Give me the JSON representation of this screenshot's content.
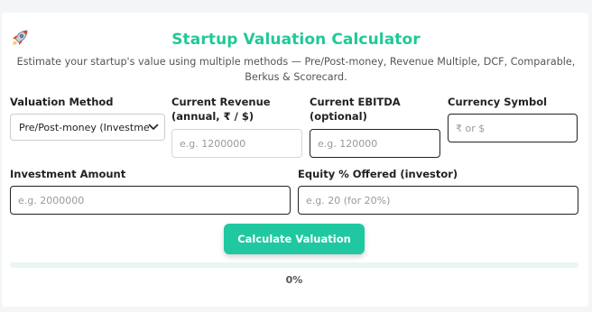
{
  "header": {
    "icon": "rocket-icon",
    "title": "Startup Valuation Calculator",
    "subtitle": "Estimate your startup's value using multiple methods — Pre/Post-money, Revenue Multiple, DCF, Comparable, Berkus & Scorecard."
  },
  "form": {
    "method": {
      "label": "Valuation Method",
      "selected": "Pre/Post-money (Investme"
    },
    "revenue": {
      "label_line1": "Current Revenue",
      "label_line2": "(annual, ₹ / $)",
      "placeholder": "e.g. 1200000"
    },
    "ebitda": {
      "label_line1": "Current EBITDA",
      "label_line2": "(optional)",
      "placeholder": "e.g. 120000"
    },
    "currency": {
      "label": "Currency Symbol",
      "placeholder": "₹ or $"
    },
    "investment": {
      "label": "Investment Amount",
      "placeholder": "e.g. 2000000"
    },
    "equity": {
      "label": "Equity % Offered (investor)",
      "placeholder": "e.g. 20 (for 20%)"
    }
  },
  "action": {
    "calculate_label": "Calculate Valuation"
  },
  "progress": {
    "value": 0,
    "label": "0%"
  },
  "colors": {
    "accent": "#20c997",
    "button": "#1fc8a0",
    "track": "#eaf6f1"
  }
}
